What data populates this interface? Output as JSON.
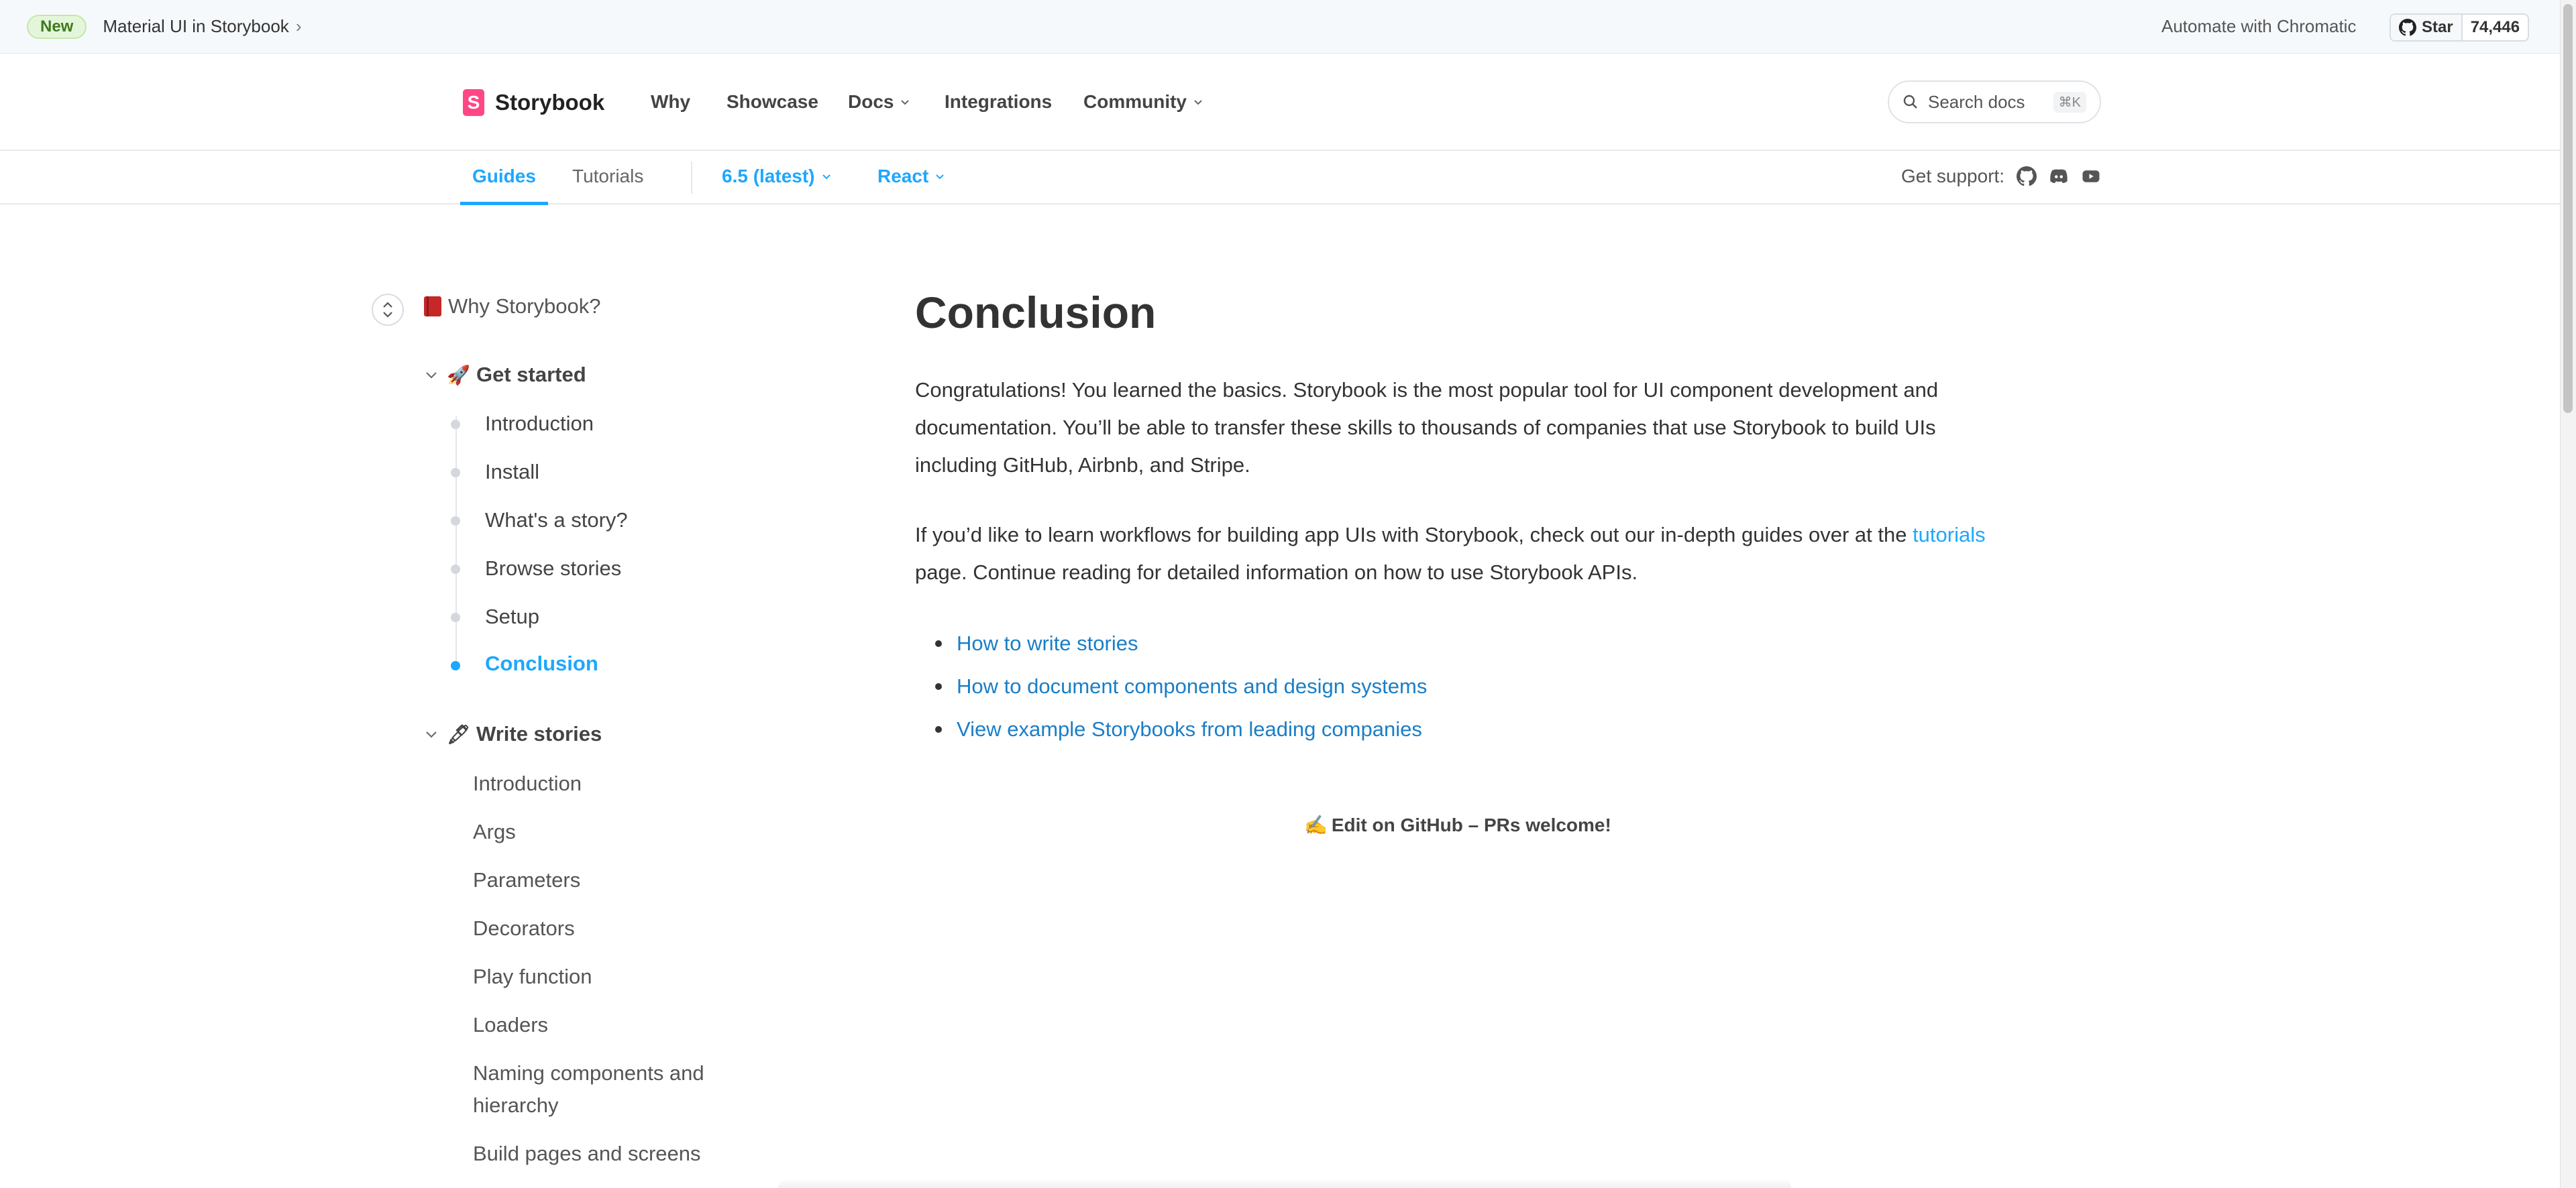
{
  "announcement": {
    "badge": "New",
    "link_text": "Material UI in Storybook",
    "chevron": "›",
    "automate_text": "Automate with Chromatic",
    "star_label": "Star",
    "star_count": "74,446"
  },
  "nav": {
    "logo_mark": "S",
    "logo_text": "Storybook",
    "items": [
      {
        "label": "Why"
      },
      {
        "label": "Showcase"
      },
      {
        "label": "Docs"
      },
      {
        "label": "Integrations"
      },
      {
        "label": "Community"
      }
    ],
    "search_placeholder": "Search docs",
    "search_shortcut": "⌘K"
  },
  "subnav": {
    "tabs": [
      {
        "label": "Guides"
      },
      {
        "label": "Tutorials"
      }
    ],
    "version": "6.5 (latest)",
    "framework": "React",
    "support_label": "Get support:"
  },
  "sidebar": {
    "top_item": "Why Storybook?",
    "groups": [
      {
        "emoji": "🚀",
        "title": "Get started",
        "items": [
          {
            "label": "Introduction"
          },
          {
            "label": "Install"
          },
          {
            "label": "What's a story?"
          },
          {
            "label": "Browse stories"
          },
          {
            "label": "Setup"
          },
          {
            "label": "Conclusion"
          }
        ]
      },
      {
        "emoji": "🖋",
        "title": "Write stories",
        "items": [
          {
            "label": "Introduction"
          },
          {
            "label": "Args"
          },
          {
            "label": "Parameters"
          },
          {
            "label": "Decorators"
          },
          {
            "label": "Play function"
          },
          {
            "label": "Loaders"
          },
          {
            "label": "Naming components and hierarchy"
          },
          {
            "label": "Build pages and screens"
          }
        ]
      }
    ]
  },
  "content": {
    "title": "Conclusion",
    "para1": "Congratulations! You learned the basics. Storybook is the most popular tool for UI component development and documentation. You’ll be able to transfer these skills to thousands of companies that use Storybook to build UIs including GitHub, Airbnb, and Stripe.",
    "para2_before": "If you’d like to learn workflows for building app UIs with Storybook, check out our in-depth guides over at the ",
    "para2_link": "tutorials",
    "para2_after": " page. Continue reading for detailed information on how to use Storybook APIs.",
    "links": [
      {
        "label": "How to write stories"
      },
      {
        "label": "How to document components and design systems"
      },
      {
        "label": "View example Storybooks from leading companies"
      }
    ],
    "edit_emoji": "✍️",
    "edit_text": "Edit on GitHub – PRs welcome!"
  },
  "colors": {
    "accent": "#1ea7fd",
    "link": "#1a7ec7",
    "brand": "#ff4785"
  }
}
